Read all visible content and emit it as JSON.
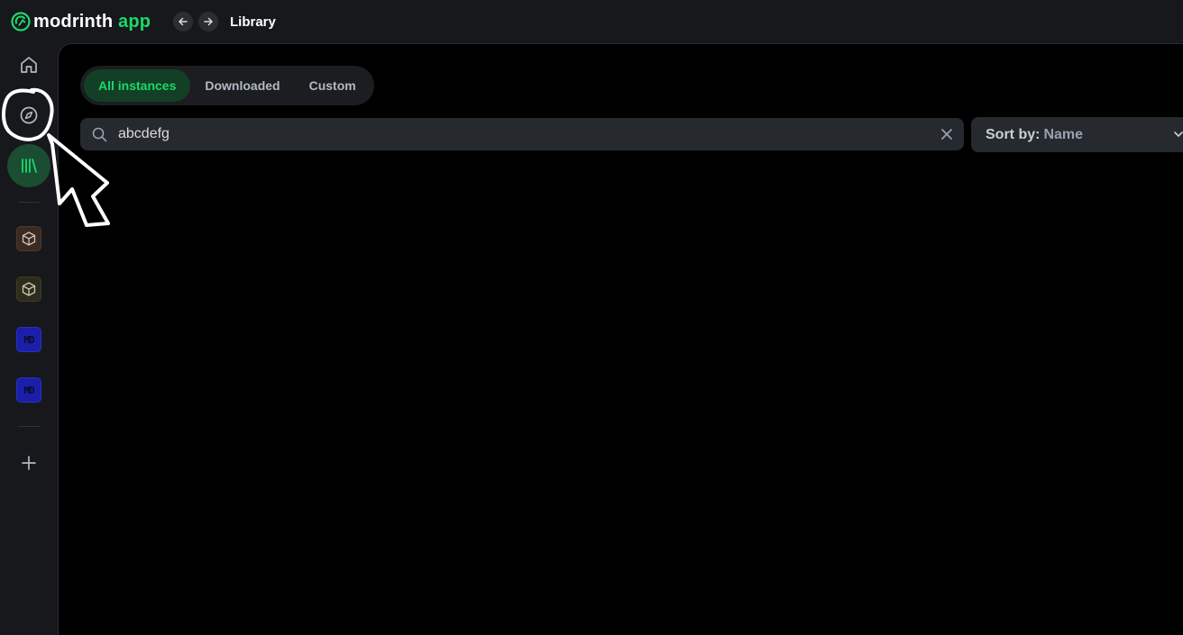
{
  "app": {
    "logo_word": "modrinth",
    "logo_suffix": "app",
    "breadcrumb": "Library"
  },
  "topbar": {
    "back_icon": "arrow-left-icon",
    "forward_icon": "arrow-right-icon"
  },
  "sidebar": {
    "items": [
      {
        "name": "home",
        "icon": "home-icon"
      },
      {
        "name": "browse",
        "icon": "compass-icon"
      },
      {
        "name": "library",
        "icon": "library-icon",
        "active": true
      }
    ],
    "instances": [
      {
        "icon": "cube-icon"
      },
      {
        "icon": "cube-icon"
      },
      {
        "icon": "md-icon",
        "label": "MD"
      },
      {
        "icon": "md-icon",
        "label": "MD"
      }
    ],
    "add_icon": "plus-icon"
  },
  "main": {
    "tabs": [
      {
        "label": "All instances",
        "active": true
      },
      {
        "label": "Downloaded",
        "active": false
      },
      {
        "label": "Custom",
        "active": false
      }
    ],
    "search": {
      "value": "abcdefg",
      "icon": "search-icon",
      "clear_icon": "close-icon"
    },
    "sort": {
      "prefix": "Sort by:",
      "value": "Name",
      "icon": "chevron-down-icon"
    }
  },
  "colors": {
    "brand": "#1bd96a",
    "background": "#16181c",
    "main_background": "#000000",
    "active_tab_bg": "#123f26",
    "input_bg": "#26292e"
  }
}
